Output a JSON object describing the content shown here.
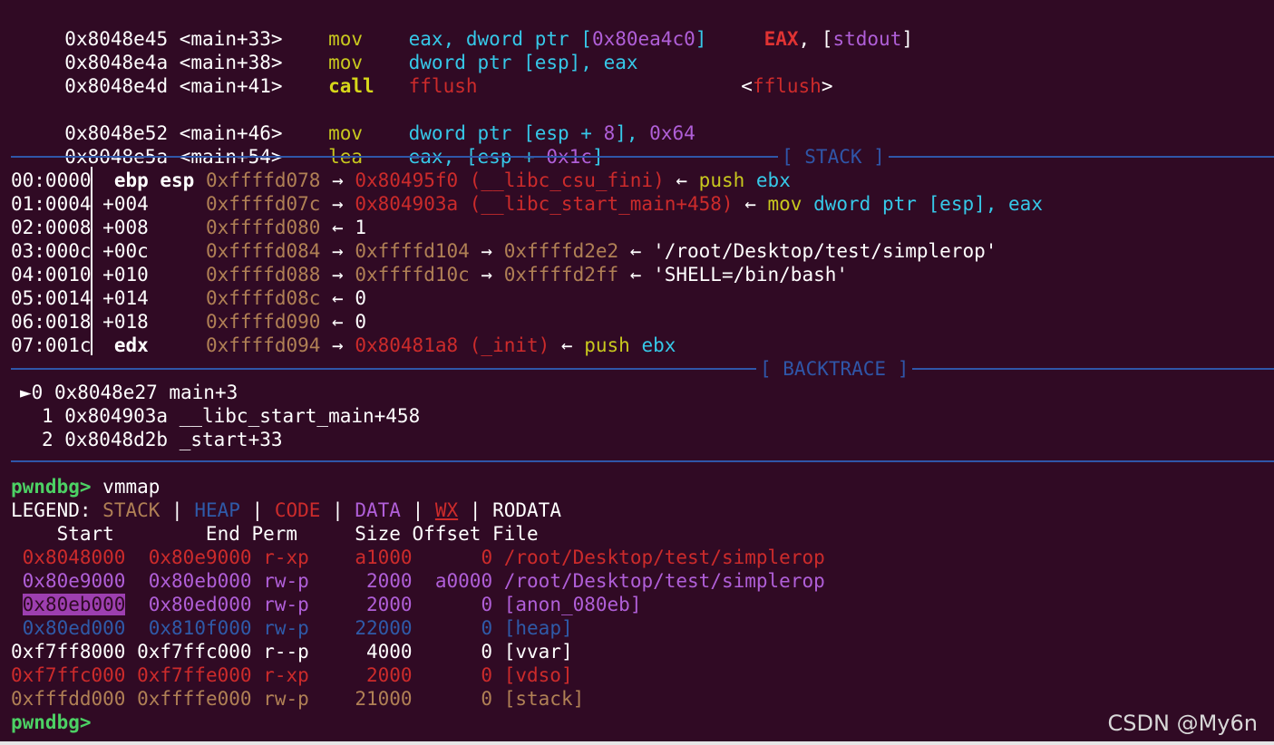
{
  "disasm": [
    {
      "addr": "0x8048e45",
      "sym": "<main+33>",
      "op": "mov",
      "args": "eax, dword ptr [0x80ea4c0]",
      "comment_reg": "EAX",
      "comment_rest": ", [stdout]"
    },
    {
      "addr": "0x8048e4a",
      "sym": "<main+38>",
      "op": "mov",
      "args": "dword ptr [esp], eax"
    },
    {
      "addr": "0x8048e4d",
      "sym": "<main+41>",
      "op": "call",
      "args": "fflush",
      "target": "<fflush>"
    },
    {
      "addr": "0x8048e52",
      "sym": "<main+46>",
      "op": "mov",
      "args": "dword ptr [esp + 8], 0x64"
    },
    {
      "addr": "0x8048e5a",
      "sym": "<main+54>",
      "op": "lea",
      "args": "eax, [esp + 0x1c]"
    }
  ],
  "stack_title": "[ STACK ]",
  "stack": [
    {
      "idx": "00:0000",
      "off": "ebp esp",
      "addr": "0xffffd078",
      "chain": "→ 0x80495f0 (__libc_csu_fini) ← push ebx"
    },
    {
      "idx": "01:0004",
      "off": "+004",
      "addr": "0xffffd07c",
      "chain": "→ 0x804903a (__libc_start_main+458) ← mov dword ptr [esp], eax"
    },
    {
      "idx": "02:0008",
      "off": "+008",
      "addr": "0xffffd080",
      "chain": "← 1"
    },
    {
      "idx": "03:000c",
      "off": "+00c",
      "addr": "0xffffd084",
      "chain": "→ 0xffffd104 → 0xffffd2e2 ← '/root/Desktop/test/simplerop'"
    },
    {
      "idx": "04:0010",
      "off": "+010",
      "addr": "0xffffd088",
      "chain": "→ 0xffffd10c → 0xffffd2ff ← 'SHELL=/bin/bash'"
    },
    {
      "idx": "05:0014",
      "off": "+014",
      "addr": "0xffffd08c",
      "chain": "← 0"
    },
    {
      "idx": "06:0018",
      "off": "+018",
      "addr": "0xffffd090",
      "chain": "← 0"
    },
    {
      "idx": "07:001c",
      "off": "edx",
      "addr": "0xffffd094",
      "chain": "→ 0x80481a8 (_init) ← push ebx"
    }
  ],
  "backtrace_title": "[ BACKTRACE ]",
  "backtrace": [
    {
      "marker": "►",
      "text": "0 0x8048e27 main+3"
    },
    {
      "marker": "",
      "text": "1 0x804903a __libc_start_main+458"
    },
    {
      "marker": "",
      "text": "2 0x8048d2b _start+33"
    }
  ],
  "prompt": "pwndbg>",
  "command": "vmmap",
  "legend": {
    "label": "LEGEND:",
    "stack": "STACK",
    "heap": "HEAP",
    "code": "CODE",
    "data": "DATA",
    "wx": "WX",
    "rodata": "RODATA"
  },
  "vmmap_header": "    Start        End Perm     Size Offset File",
  "vmmap": [
    {
      "start": "0x8048000",
      "end": "0x80e9000",
      "perm": "r-xp",
      "size": "a1000",
      "offset": "0",
      "file": "/root/Desktop/test/simplerop",
      "kind": "code"
    },
    {
      "start": "0x80e9000",
      "end": "0x80eb000",
      "perm": "rw-p",
      "size": "2000",
      "offset": "a0000",
      "file": "/root/Desktop/test/simplerop",
      "kind": "data"
    },
    {
      "start": "0x80eb000",
      "end": "0x80ed000",
      "perm": "rw-p",
      "size": "2000",
      "offset": "0",
      "file": "[anon_080eb]",
      "kind": "data"
    },
    {
      "start": "0x80ed000",
      "end": "0x810f000",
      "perm": "rw-p",
      "size": "22000",
      "offset": "0",
      "file": "[heap]",
      "kind": "heap"
    },
    {
      "start": "0xf7ff8000",
      "end": "0xf7ffc000",
      "perm": "r--p",
      "size": "4000",
      "offset": "0",
      "file": "[vvar]",
      "kind": "rodata"
    },
    {
      "start": "0xf7ffc000",
      "end": "0xf7ffe000",
      "perm": "r-xp",
      "size": "2000",
      "offset": "0",
      "file": "[vdso]",
      "kind": "code"
    },
    {
      "start": "0xfffdd000",
      "end": "0xffffe000",
      "perm": "rw-p",
      "size": "21000",
      "offset": "0",
      "file": "[stack]",
      "kind": "stack"
    }
  ],
  "final_prompt": "pwndbg>",
  "watermark": "CSDN @My6n"
}
